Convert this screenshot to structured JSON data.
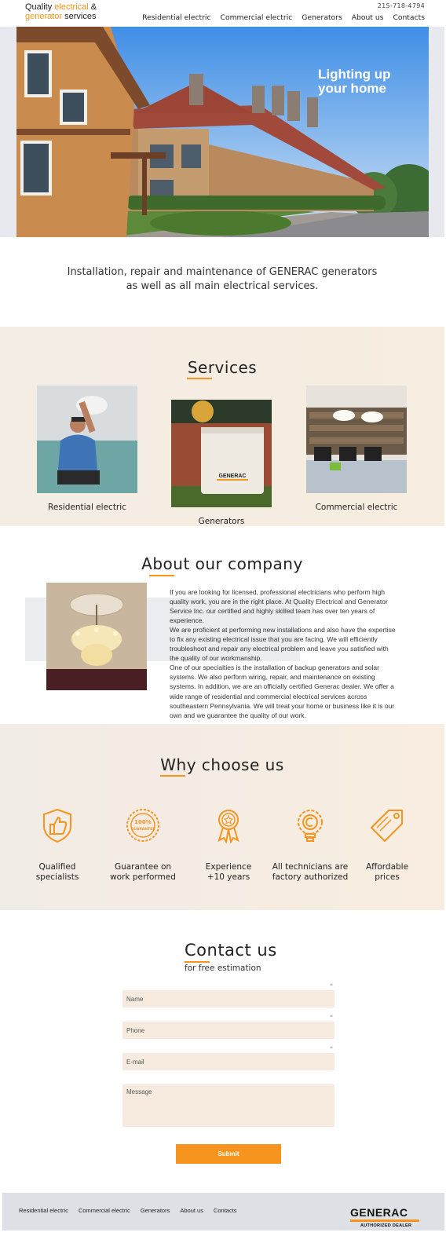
{
  "header": {
    "logo_line1_a": "Quality ",
    "logo_line1_b": "electrical",
    "logo_line1_c": " &",
    "logo_line2_a": "generator",
    "logo_line2_b": " services",
    "phone": "215-718-4794",
    "nav": [
      "Residential electric",
      "Commercial electric",
      "Generators",
      "About us",
      "Contacts"
    ]
  },
  "hero": {
    "title": "Lighting up\nyour home"
  },
  "intro": {
    "text": "Installation, repair and maintenance of GENERAC generators as well as all main electrical services."
  },
  "services": {
    "title": "Services",
    "items": [
      {
        "label": "Residential electric"
      },
      {
        "label": "Generators"
      },
      {
        "label": "Commercial electric"
      }
    ]
  },
  "about": {
    "title": "About our company",
    "paragraphs": [
      "If you are looking for licensed, professional electricians who perform high quality work, you are in the right place. At Quality Electrical and Generator Service Inc. our certified and highly skilled team has over ten years of experience.",
      "We are proficient at performing new installations and also have the expertise to fix any existing electrical issue that you are facing. We will efficiently troubleshoot and repair any electrical problem and leave you satisfied with the quality of our workmanship.",
      "One of our specialties is the installation of backup generators and solar systems. We also perform wiring, repair, and maintenance on existing systems. In addition, we are an officially certified Generac dealer. We offer a wide range of residential and commercial electrical services across southeastern Pennsylvania. We will treat your home or business like it is our own and we guarantee the quality of our work."
    ]
  },
  "why": {
    "title": "Why choose us",
    "badge_text_1": "100%",
    "badge_text_2": "GUARANTEE",
    "items": [
      {
        "label": "Qualified\nspecialists"
      },
      {
        "label": "Guarantee on\nwork performed"
      },
      {
        "label": "Experience\n+10 years"
      },
      {
        "label": "All technicians are\n factory authorized"
      },
      {
        "label": "Affordable\nprices"
      }
    ]
  },
  "contact": {
    "title": "Contact us",
    "subtitle": "for free estimation",
    "name_placeholder": "Name",
    "phone_placeholder": "Phone",
    "email_placeholder": "E-mail",
    "message_placeholder": "Message",
    "required_mark": "*",
    "submit_label": "Submit"
  },
  "footer": {
    "nav": [
      "Residential electric",
      "Commercial electric",
      "Generators",
      "About us",
      "Contacts"
    ],
    "brand": "GENERAC",
    "brand_sub": "AUTHORIZED DEALER"
  },
  "colors": {
    "accent": "#f7941d",
    "section_bg": "#f6ede3",
    "footer_bg": "#dde0e4"
  }
}
